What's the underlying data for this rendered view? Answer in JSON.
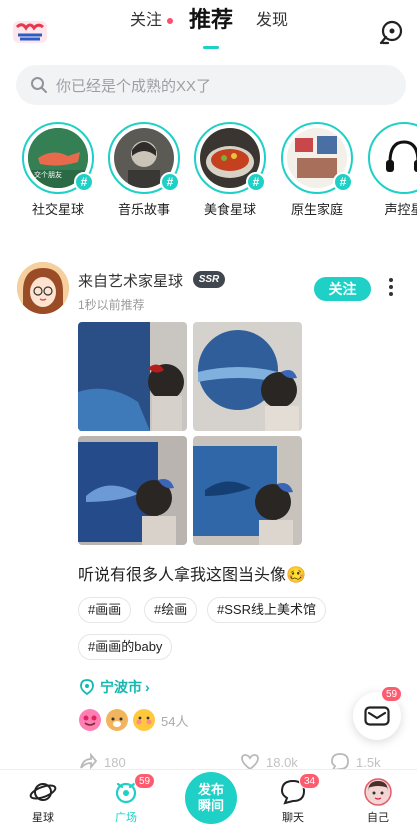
{
  "nav": {
    "tabs": [
      {
        "label": "关注",
        "has_dot": true
      },
      {
        "label": "推荐",
        "active": true
      },
      {
        "label": "发现"
      }
    ]
  },
  "search": {
    "placeholder": "你已经是个成熟的XX了"
  },
  "planets": [
    {
      "label": "社交星球",
      "inner_text": "交个朋友"
    },
    {
      "label": "音乐故事"
    },
    {
      "label": "美食星球"
    },
    {
      "label": "原生家庭"
    },
    {
      "label": "声控星"
    }
  ],
  "post": {
    "author": "来自艺术家星球",
    "level_badge": "SSR",
    "time": "1秒以前推荐",
    "follow_label": "关注",
    "text": "听说有很多人拿我这图当头像🥴",
    "tags": [
      "#画画",
      "#绘画",
      "#SSR线上美术馆",
      "#画画的baby"
    ],
    "location": "宁波市",
    "reaction_count": "54人",
    "actions": {
      "share": "180",
      "like": "18.0k",
      "comment": "1.5k"
    }
  },
  "mail": {
    "badge": "59"
  },
  "bottom_nav": [
    {
      "label": "星球"
    },
    {
      "label": "广场",
      "badge": "59",
      "active": true
    },
    {
      "label": "发布\n瞬间"
    },
    {
      "label": "聊天",
      "badge": "34"
    },
    {
      "label": "自己"
    }
  ],
  "publish": {
    "line1": "发布",
    "line2": "瞬间"
  },
  "colors": {
    "accent": "#1ed0c5",
    "badge": "#ff5b6e"
  }
}
